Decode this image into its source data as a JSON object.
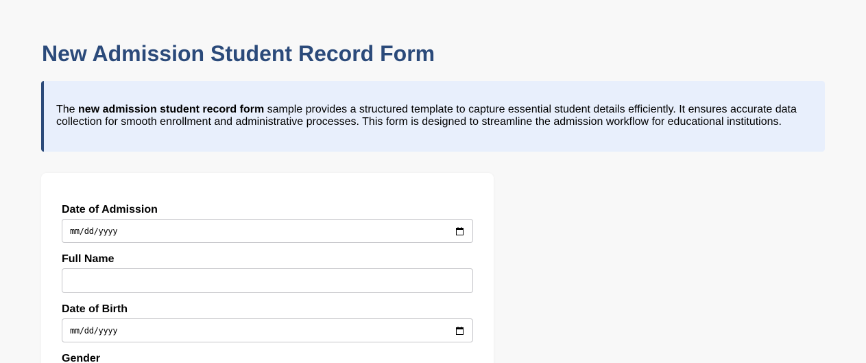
{
  "page": {
    "title": "New Admission Student Record Form"
  },
  "intro": {
    "prefix": "The ",
    "emphasis": "new admission student record form",
    "suffix": " sample provides a structured template to capture essential student details efficiently. It ensures accurate data collection for smooth enrollment and administrative processes. This form is designed to streamline the admission workflow for educational institutions."
  },
  "form": {
    "date_of_admission": {
      "label": "Date of Admission",
      "placeholder": "mm/dd/yyyy",
      "icon": "calendar-icon"
    },
    "full_name": {
      "label": "Full Name",
      "value": ""
    },
    "date_of_birth": {
      "label": "Date of Birth",
      "placeholder": "mm/dd/yyyy",
      "icon": "calendar-icon"
    },
    "gender": {
      "label": "Gender"
    }
  },
  "colors": {
    "title": "#2b4a7a",
    "intro_bg": "#e8effc",
    "intro_border": "#2b4a7a",
    "page_bg": "#f8f8f8",
    "card_bg": "#ffffff"
  }
}
